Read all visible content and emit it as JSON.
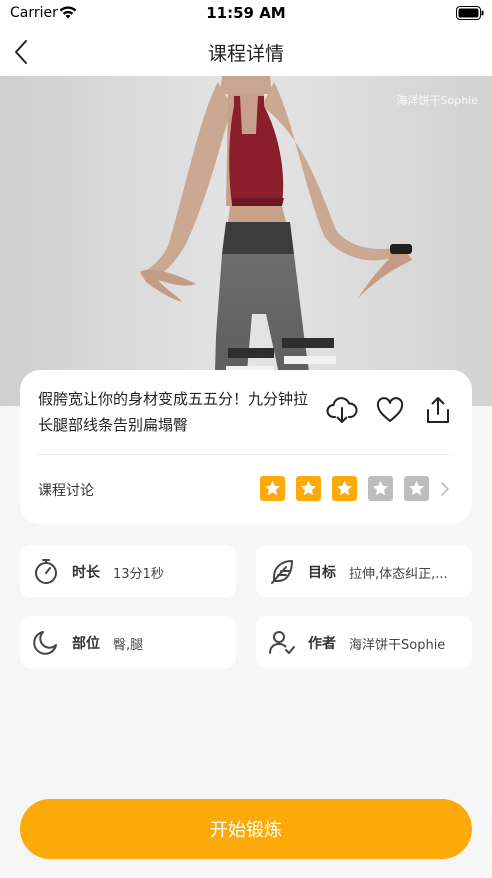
{
  "status_bar": {
    "carrier": "Carrier",
    "time": "11:59 AM"
  },
  "nav": {
    "title": "课程详情",
    "back_icon": "chevron-left-icon"
  },
  "hero": {
    "watermark": "海洋饼干Sophie"
  },
  "course": {
    "title": "假胯宽让你的身材变成五五分！九分钟拉长腿部线条告别扁塌臀",
    "actions": [
      "download-icon",
      "heart-icon",
      "share-icon"
    ],
    "discussion_label": "课程讨论",
    "rating": 3,
    "max_rating": 5
  },
  "stats": {
    "duration": {
      "label": "时长",
      "value": "13分1秒",
      "icon": "stopwatch-icon"
    },
    "goal": {
      "label": "目标",
      "value": "拉伸,体态纠正,...",
      "icon": "feather-icon"
    },
    "body_part": {
      "label": "部位",
      "value": "臀,腿",
      "icon": "moon-icon"
    },
    "author": {
      "label": "作者",
      "value": "海洋饼干Sophie",
      "icon": "user-check-icon"
    }
  },
  "start_button": {
    "label": "开始锻炼"
  },
  "colors": {
    "accent": "#fcaa0a",
    "star_empty": "#bdbdbd",
    "background": "#f6f6f6"
  }
}
